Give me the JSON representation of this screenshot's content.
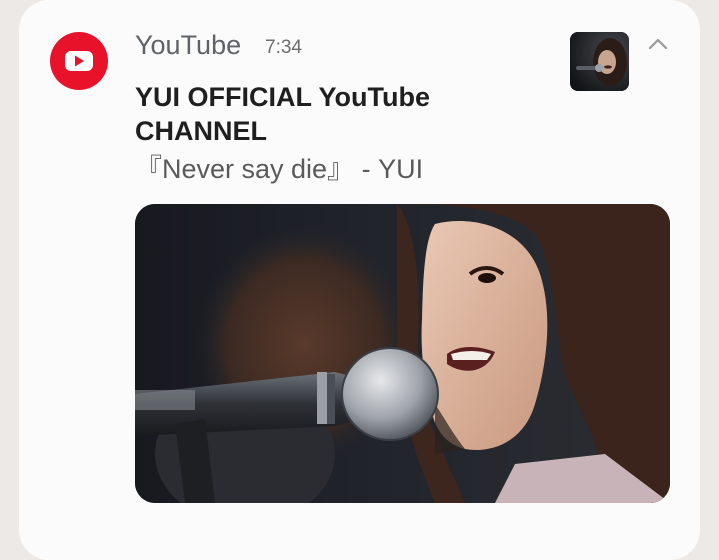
{
  "notification": {
    "app_name": "YouTube",
    "time": "7:34",
    "title": "YUI OFFICIAL YouTube CHANNEL",
    "subtitle": "『Never say die』 - YUI",
    "app_icon": "youtube-play-icon",
    "expand_icon": "chevron-up-icon"
  },
  "colors": {
    "brand": "#e8122b",
    "card_background": "#fbfbfb",
    "page_background": "#ece9e6"
  }
}
